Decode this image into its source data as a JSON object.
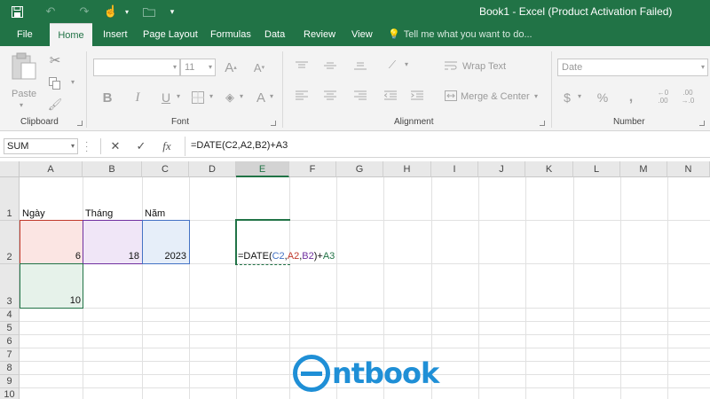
{
  "window": {
    "title": "Book1 - Excel (Product Activation Failed)"
  },
  "quick_access": [
    {
      "name": "save-icon",
      "glyph": "🖫"
    },
    {
      "name": "undo-icon",
      "glyph": "↶"
    },
    {
      "name": "redo-icon",
      "glyph": "↷"
    },
    {
      "name": "touch-mode-icon",
      "glyph": "☝"
    },
    {
      "name": "open-icon",
      "glyph": "▭"
    },
    {
      "name": "customize-qat-icon",
      "glyph": "▾"
    }
  ],
  "tabs": [
    "File",
    "Home",
    "Insert",
    "Page Layout",
    "Formulas",
    "Data",
    "Review",
    "View"
  ],
  "active_tab": "Home",
  "tell_me": "Tell me what you want to do...",
  "ribbon": {
    "clipboard": {
      "label": "Clipboard",
      "paste": "Paste"
    },
    "font": {
      "label": "Font",
      "font_name": "",
      "font_size": "11"
    },
    "alignment": {
      "label": "Alignment",
      "wrap_text": "Wrap Text",
      "merge_center": "Merge & Center"
    },
    "number": {
      "label": "Number",
      "format": "Date"
    }
  },
  "formula_bar": {
    "name_box": "SUM",
    "formula": "=DATE(C2,A2,B2)+A3",
    "fx": "fx"
  },
  "grid": {
    "columns": [
      "A",
      "B",
      "C",
      "D",
      "E",
      "F",
      "G",
      "H",
      "I",
      "J",
      "K",
      "L",
      "M",
      "N"
    ],
    "selected_column": "E",
    "rows": [
      "1",
      "2",
      "3",
      "4",
      "5",
      "6",
      "7",
      "8",
      "9",
      "10"
    ],
    "cells": {
      "A1": "Ngày",
      "B1": "Tháng",
      "C1": "Năm",
      "A2": "6",
      "B2": "18",
      "C2": "2023",
      "A3": "10"
    },
    "edit_cell": {
      "prefix": "=DATE(",
      "ref1": "C2",
      "sep1": ",",
      "ref2": "A2",
      "sep2": ",",
      "ref3": "B2",
      "close": ")+",
      "ref4": "A3"
    },
    "ref_colors": {
      "C2": "#4472c4",
      "A2": "#c0392b",
      "B2": "#7030a0",
      "A3": "#217346"
    }
  },
  "watermark": {
    "brand": "ntbook"
  }
}
